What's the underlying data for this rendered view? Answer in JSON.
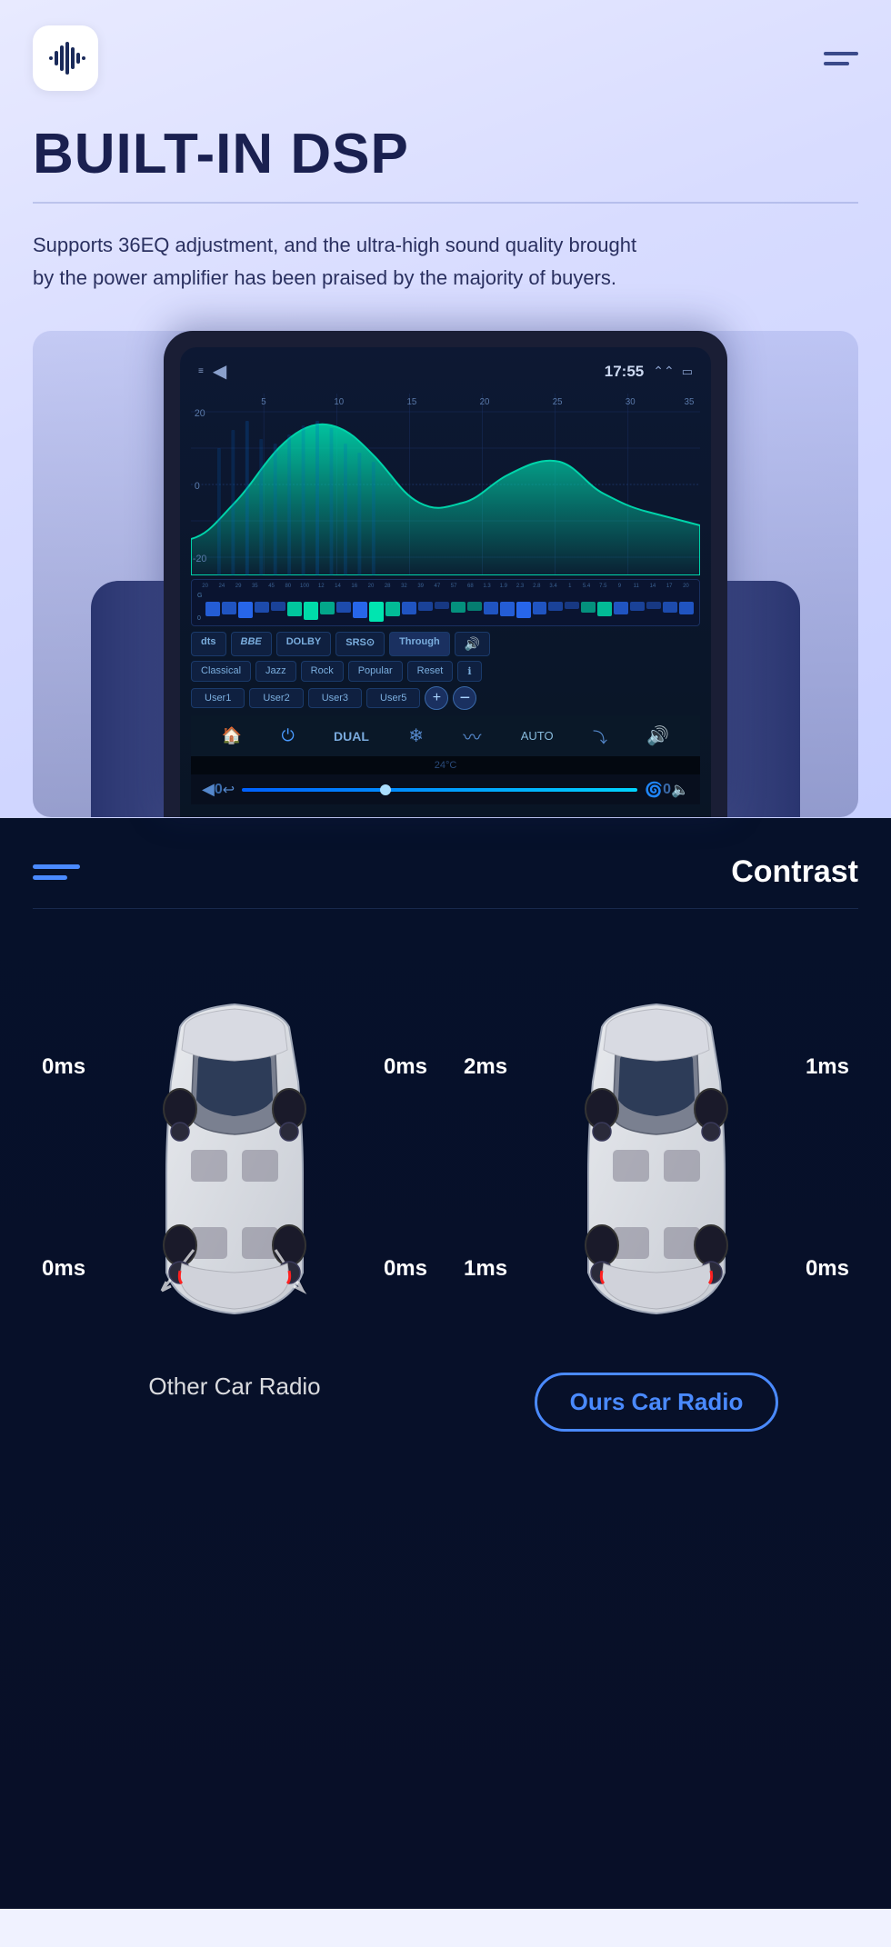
{
  "header": {
    "title": "BUILT-IN DSP",
    "description": "Supports 36EQ adjustment, and the ultra-high sound quality brought by the power amplifier has been praised by the majority of buyers.",
    "logo_alt": "audio-logo",
    "menu_label": "menu"
  },
  "dsp_screen": {
    "time": "17:55",
    "back_btn": "◀",
    "top_numbers": [
      "5",
      "10",
      "15",
      "20",
      "25",
      "30",
      "35"
    ],
    "left_labels": [
      "20",
      "0",
      "-20"
    ],
    "mode_buttons": [
      "dts",
      "BBE",
      "DOLBY",
      "SRS⊙",
      "Through",
      "🔊"
    ],
    "preset_buttons": [
      "Classical",
      "Jazz",
      "Rock",
      "Popular",
      "Reset",
      "ℹ"
    ],
    "user_buttons": [
      "User1",
      "User2",
      "User3",
      "User5"
    ],
    "plus_btn": "+",
    "minus_btn": "−",
    "ac_temp": "24°C",
    "ac_mode": "AUTO",
    "eq_bars": [
      3,
      5,
      8,
      12,
      15,
      18,
      14,
      10,
      8,
      12,
      16,
      20,
      18,
      14,
      10,
      8,
      6,
      10,
      14,
      18,
      16,
      12,
      8,
      6,
      4,
      8,
      12,
      10,
      7,
      5,
      8,
      12,
      15,
      11,
      7,
      4
    ]
  },
  "contrast_section": {
    "title": "Contrast",
    "left_car": {
      "labels": {
        "tl": "0ms",
        "tr": "0ms",
        "bl": "0ms",
        "br": "0ms"
      },
      "caption": "Other Car Radio"
    },
    "right_car": {
      "labels": {
        "tl": "2ms",
        "tr": "1ms",
        "bl": "1ms",
        "br": "0ms"
      },
      "caption": "Ours Car Radio"
    }
  }
}
